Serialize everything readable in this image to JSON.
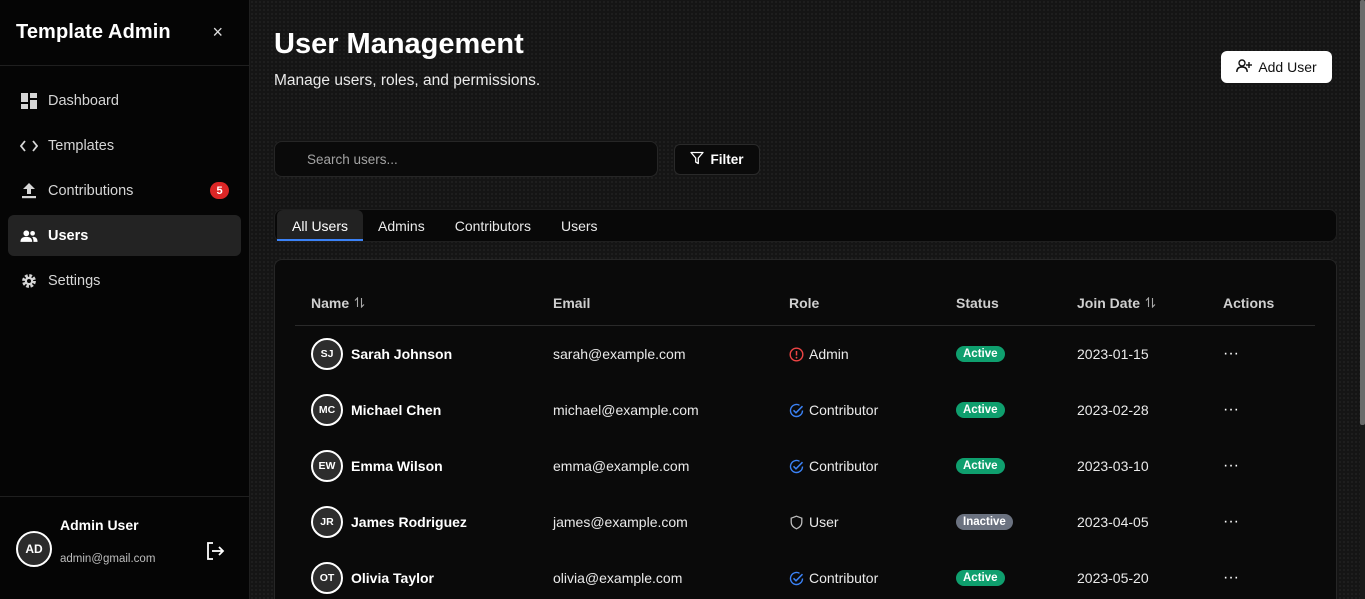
{
  "sidebar": {
    "brand": "Template Admin",
    "close_label": "×",
    "items": [
      {
        "label": "Dashboard",
        "icon": "dashboard-icon"
      },
      {
        "label": "Templates",
        "icon": "code-icon"
      },
      {
        "label": "Contributions",
        "icon": "upload-icon",
        "badge": "5"
      },
      {
        "label": "Users",
        "icon": "users-icon",
        "active": true
      },
      {
        "label": "Settings",
        "icon": "gear-icon"
      }
    ],
    "footer": {
      "avatar_initials": "AD",
      "name": "Admin User",
      "email": "admin@gmail.com"
    }
  },
  "header": {
    "title": "User Management",
    "subtitle": "Manage users, roles, and permissions.",
    "add_user_label": "Add User"
  },
  "search": {
    "placeholder": "Search users...",
    "value": ""
  },
  "filter_label": "Filter",
  "tabs": [
    {
      "label": "All Users",
      "active": true
    },
    {
      "label": "Admins"
    },
    {
      "label": "Contributors"
    },
    {
      "label": "Users"
    }
  ],
  "table": {
    "columns": {
      "name": "Name",
      "email": "Email",
      "role": "Role",
      "status": "Status",
      "join_date": "Join Date",
      "actions": "Actions"
    },
    "rows": [
      {
        "initials": "SJ",
        "name": "Sarah Johnson",
        "email": "sarah@example.com",
        "role": "Admin",
        "status": "Active",
        "join_date": "2023-01-15"
      },
      {
        "initials": "MC",
        "name": "Michael Chen",
        "email": "michael@example.com",
        "role": "Contributor",
        "status": "Active",
        "join_date": "2023-02-28"
      },
      {
        "initials": "EW",
        "name": "Emma Wilson",
        "email": "emma@example.com",
        "role": "Contributor",
        "status": "Active",
        "join_date": "2023-03-10"
      },
      {
        "initials": "JR",
        "name": "James Rodriguez",
        "email": "james@example.com",
        "role": "User",
        "status": "Inactive",
        "join_date": "2023-04-05"
      },
      {
        "initials": "OT",
        "name": "Olivia Taylor",
        "email": "olivia@example.com",
        "role": "Contributor",
        "status": "Active",
        "join_date": "2023-05-20"
      }
    ],
    "actions_glyph": "···"
  },
  "colors": {
    "accent_blue": "#3b82f6",
    "admin_red": "#ef4444",
    "status_active": "#0f9f6e",
    "status_inactive": "#6b7280",
    "badge_red": "#dc2626"
  }
}
